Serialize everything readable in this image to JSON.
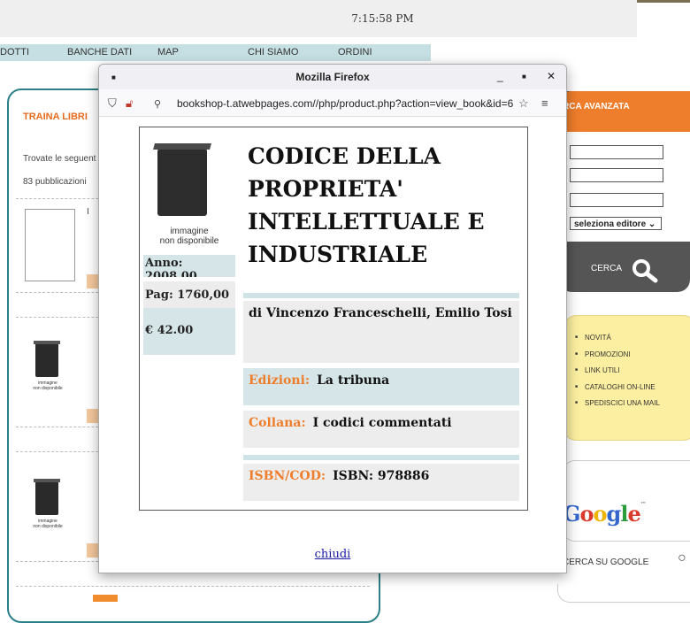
{
  "clock": "7:15:58 PM",
  "nav": [
    "DOTTI",
    "BANCHE DATI",
    "MAP",
    "CHI SIAMO",
    "ORDINI"
  ],
  "left": {
    "title": "TRAINA LIBRI",
    "found": "Trovate le seguent",
    "count": "83 pubblicazioni",
    "book_caption": "immagine\nnon disponibile"
  },
  "right": {
    "adv_title": "RCA AVANZATA",
    "select": "seleziona editore",
    "cerca": "CERCA",
    "links": [
      "NOVITÁ",
      "PROMOZIONI",
      "LINK UTILI",
      "CATALOGHI ON-LINE",
      "SPEDISCICI UNA MAIL"
    ],
    "google": "Google",
    "cerca_google": "CERCA SU GOOGLE"
  },
  "firefox": {
    "title": "Mozilla Firefox",
    "url": "bookshop-t.atwebpages.com//php/product.php?action=view_book&id=6"
  },
  "book": {
    "cover_caption": "immagine\nnon disponibile",
    "anno": "Anno: 2008,00",
    "pag": "Pag: 1760,00",
    "prezzo": "€ 42.00",
    "title": "CODICE DELLA PROPRIETA' INTELLETTUALE E INDUSTRIALE",
    "authors": "di Vincenzo Franceschelli, Emilio Tosi",
    "edizioni_label": "Edizioni:",
    "edizioni": "La tribuna",
    "collana_label": "Collana:",
    "collana": "I codici commentati",
    "isbn_label": "ISBN/COD:",
    "isbn": "ISBN: 978886"
  },
  "close": "chiudi"
}
